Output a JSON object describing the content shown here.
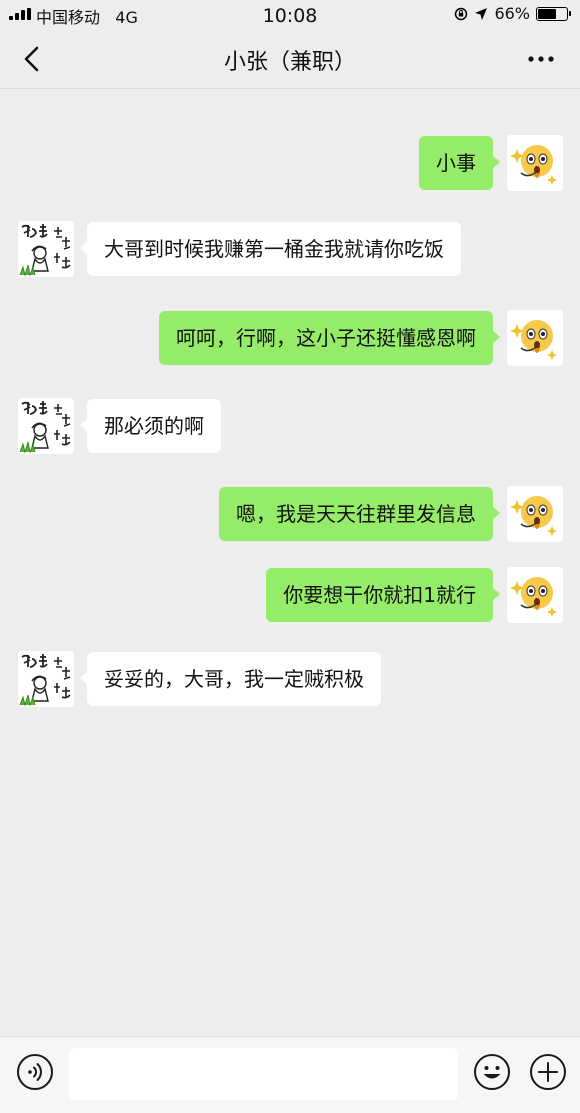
{
  "status_bar": {
    "carrier": "中国移动",
    "network": "4G",
    "time": "10:08",
    "battery_text": "66%",
    "battery_level": 0.66
  },
  "nav": {
    "title": "小张（兼职）"
  },
  "messages": [
    {
      "side": "right",
      "text": "小事"
    },
    {
      "side": "left",
      "text": "大哥到时候我赚第一桶金我就请你吃饭"
    },
    {
      "side": "right",
      "text": "呵呵，行啊，这小子还挺懂感恩啊"
    },
    {
      "side": "left",
      "text": "那必须的啊"
    },
    {
      "side": "right",
      "text": "嗯，我是天天往群里发信息"
    },
    {
      "side": "right",
      "text": "你要想干你就扣1就行"
    },
    {
      "side": "left",
      "text": "妥妥的，大哥，我一定贼积极"
    }
  ],
  "avatars": {
    "self": "surprised-emoji-avatar",
    "contact": "meme-sticker-avatar"
  },
  "colors": {
    "background": "#ededed",
    "outgoing_bubble": "#95ec69",
    "incoming_bubble": "#ffffff"
  },
  "input_bar": {
    "voice_icon": "voice-icon",
    "emoji_icon": "emoji-icon",
    "plus_icon": "plus-icon"
  }
}
